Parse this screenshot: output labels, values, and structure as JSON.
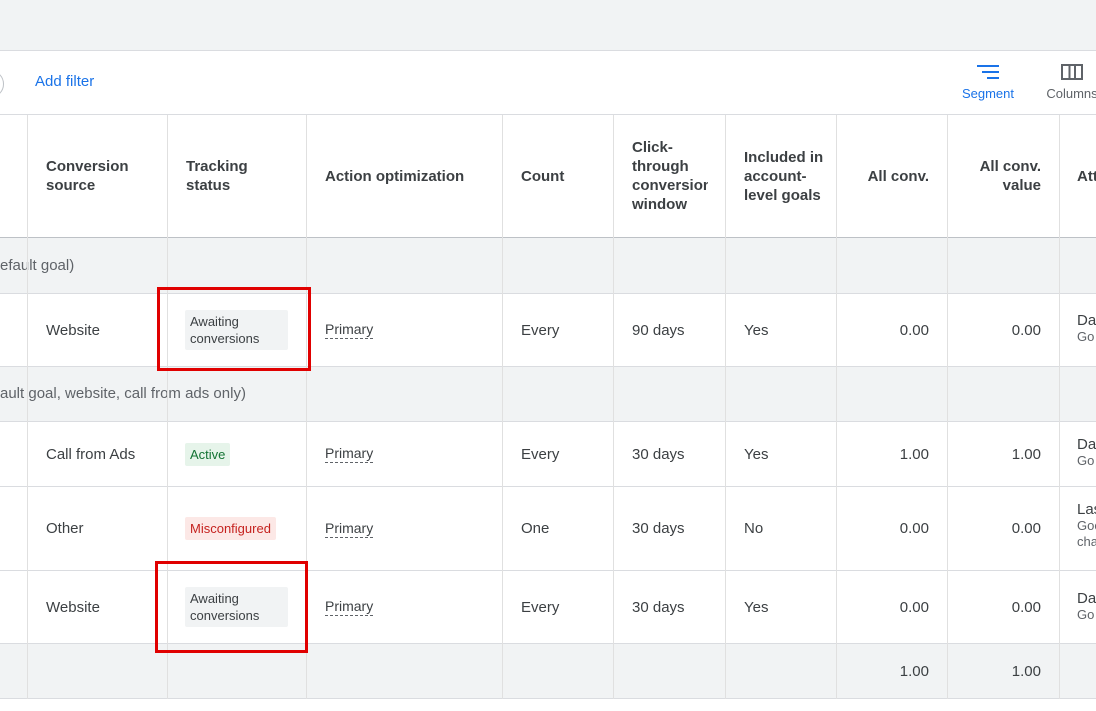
{
  "toolbar": {
    "add_filter": "Add filter",
    "segment_label": "Segment",
    "columns_label": "Columns"
  },
  "table": {
    "headers": {
      "source": "Conversion source",
      "tracking": "Tracking status",
      "action": "Action optimization",
      "count": "Count",
      "click": "Click-through conversion window",
      "included": "Included in account-level goals",
      "allconv": "All conv.",
      "allconvvalue": "All conv. value",
      "attr": "Att"
    },
    "groups": [
      {
        "label": "efault goal)",
        "rows": [
          {
            "source": "Website",
            "tracking": "Awaiting conversions",
            "action": "Primary",
            "count": "Every",
            "window": "90 days",
            "included": "Yes",
            "allconv": "0.00",
            "allconvvalue": "0.00",
            "attr_main": "Da",
            "attr_sub": "Go",
            "attr_sub2": ""
          }
        ]
      },
      {
        "label": "ault goal, website, call from ads only)",
        "rows": [
          {
            "source": "Call from Ads",
            "tracking": "Active",
            "action": "Primary",
            "count": "Every",
            "window": "30 days",
            "included": "Yes",
            "allconv": "1.00",
            "allconvvalue": "1.00",
            "attr_main": "Da",
            "attr_sub": "Go",
            "attr_sub2": ""
          },
          {
            "source": "Other",
            "tracking": "Misconfigured",
            "action": "Primary",
            "count": "One",
            "window": "30 days",
            "included": "No",
            "allconv": "0.00",
            "allconvvalue": "0.00",
            "attr_main": "Las",
            "attr_sub": "Goo",
            "attr_sub2": "cha"
          },
          {
            "source": "Website",
            "tracking": "Awaiting conversions",
            "action": "Primary",
            "count": "Every",
            "window": "30 days",
            "included": "Yes",
            "allconv": "0.00",
            "allconvvalue": "0.00",
            "attr_main": "Da",
            "attr_sub": "Go",
            "attr_sub2": ""
          }
        ]
      }
    ],
    "totals": {
      "allconv": "1.00",
      "allconvvalue": "1.00"
    }
  },
  "colors": {
    "accent": "#1a73e8",
    "highlight": "#e00000",
    "active_bg": "#e6f4ea",
    "misconfigured_bg": "#fce8e6"
  }
}
